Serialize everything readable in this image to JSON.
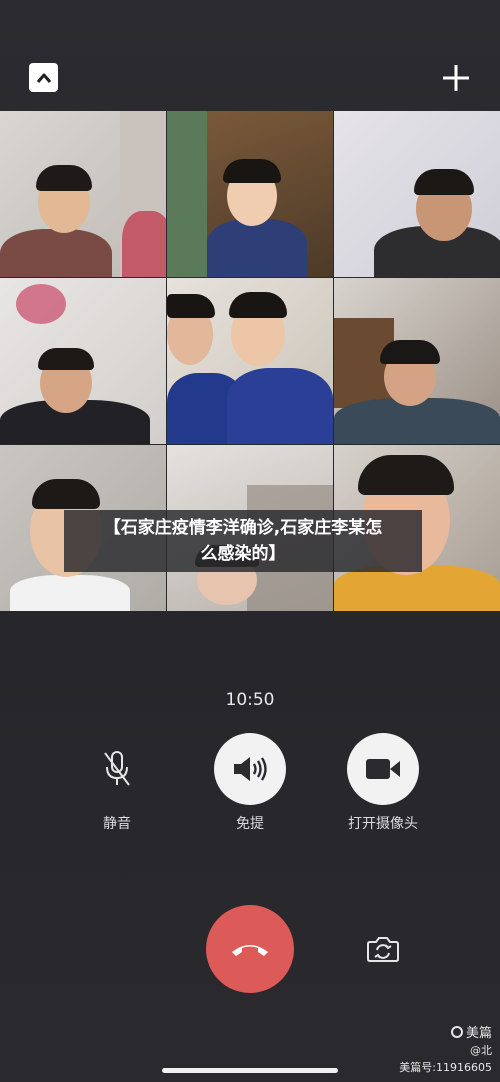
{
  "call": {
    "timer": "10:50",
    "caption_line1": "【石家庄疫情李洋确诊,石家庄李某怎",
    "caption_line2": "么感染的】"
  },
  "topbar": {
    "collapse_icon": "chevron-up-icon",
    "add_icon": "plus-icon"
  },
  "controls": {
    "mute_label": "静音",
    "speaker_label": "免提",
    "camera_label": "打开摄像头",
    "hangup_icon": "hangup-phone-icon",
    "flip_icon": "flip-camera-icon"
  },
  "watermark": {
    "brand": "美篇",
    "handle": "@北",
    "id": "美篇号:11916605"
  },
  "colors": {
    "background": "#2a2a2f",
    "hangup": "#dc5a57",
    "control_active": "#f2f2f2"
  }
}
